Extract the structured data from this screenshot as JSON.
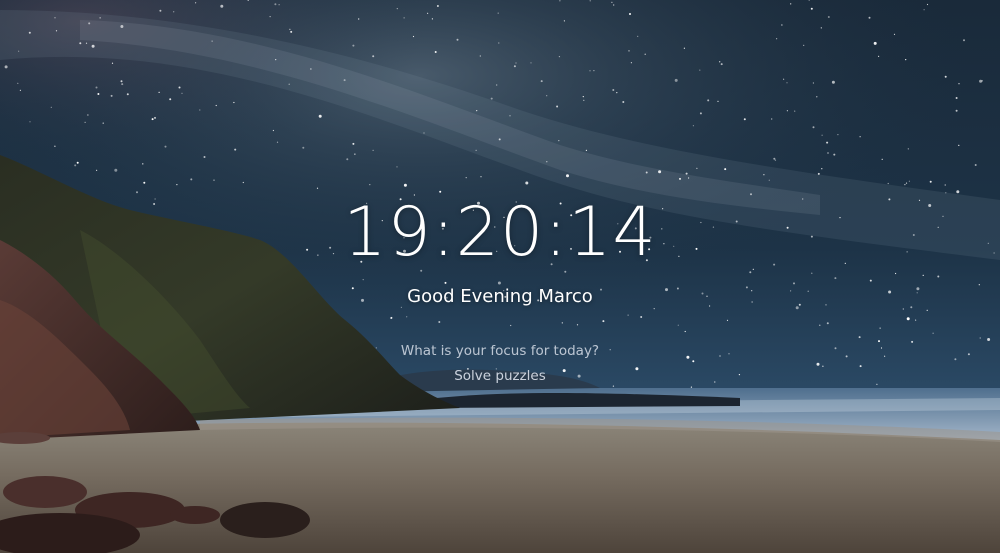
{
  "clock": {
    "time": "19:20:14"
  },
  "greeting": {
    "text": "Good Evening Marco"
  },
  "focus": {
    "question": "What is your focus for today?",
    "value": "Solve puzzles"
  },
  "colors": {
    "text": "#ffffff",
    "muted_text": "#dce2ec",
    "sky": "#14283a",
    "sand": "#7d7468",
    "sea": "#8ea6bf"
  }
}
